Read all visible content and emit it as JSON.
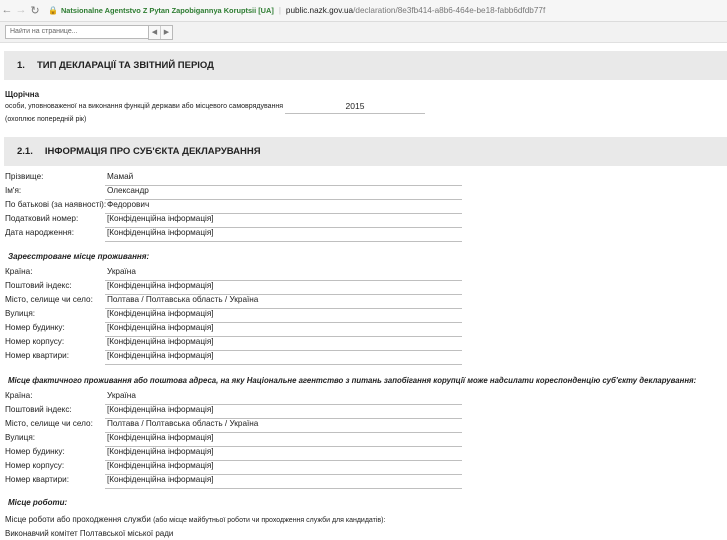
{
  "browser": {
    "site_name": "Natsionalne Agentstvo Z Pytan Zapobigannya Koruptsii [UA]",
    "host": "public.nazk.gov.ua",
    "path": "/declaration/8e3fb414-a8b6-464e-be18-fabb6dfdb77f"
  },
  "findbar": {
    "placeholder": "Найти на странице..."
  },
  "section1": {
    "number": "1.",
    "title": "ТИП ДЕКЛАРАЦІЇ ТА ЗВІТНИЙ ПЕРІОД",
    "type": "Щорічна",
    "desc": "особи, уповноваженої на виконання функцій держави або місцевого самоврядування",
    "period_note": "(охоплює попередній рік)",
    "year": "2015"
  },
  "section21": {
    "number": "2.1.",
    "title": "ІНФОРМАЦІЯ ПРО СУБ'ЄКТА ДЕКЛАРУВАННЯ",
    "personal": [
      {
        "label": "Прізвище:",
        "value": "Мамай"
      },
      {
        "label": "Ім'я:",
        "value": "Олександр"
      },
      {
        "label": "По батькові (за наявності):",
        "value": "Федорович"
      },
      {
        "label": "Податковий номер:",
        "value": "[Конфіденційна інформація]"
      },
      {
        "label": "Дата народження:",
        "value": "[Конфіденційна інформація]"
      }
    ],
    "registered_heading": "Зареєстроване місце проживання:",
    "registered": [
      {
        "label": "Країна:",
        "value": "Україна"
      },
      {
        "label": "Поштовий індекс:",
        "value": "[Конфіденційна інформація]"
      },
      {
        "label": "Місто, селище чи село:",
        "value": "Полтава / Полтавська область / Україна"
      },
      {
        "label": "Вулиця:",
        "value": "[Конфіденційна інформація]"
      },
      {
        "label": "Номер будинку:",
        "value": "[Конфіденційна інформація]"
      },
      {
        "label": "Номер корпусу:",
        "value": "[Конфіденційна інформація]"
      },
      {
        "label": "Номер квартири:",
        "value": "[Конфіденційна інформація]"
      }
    ],
    "actual_heading": "Місце фактичного проживання або поштова адреса, на яку Національне агентство з питань запобігання корупції може надсилати кореспонденцію суб'єкту декларування:",
    "actual": [
      {
        "label": "Країна:",
        "value": "Україна"
      },
      {
        "label": "Поштовий індекс:",
        "value": "[Конфіденційна інформація]"
      },
      {
        "label": "Місто, селище чи село:",
        "value": "Полтава / Полтавська область / Україна"
      },
      {
        "label": "Вулиця:",
        "value": "[Конфіденційна інформація]"
      },
      {
        "label": "Номер будинку:",
        "value": "[Конфіденційна інформація]"
      },
      {
        "label": "Номер корпусу:",
        "value": "[Конфіденційна інформація]"
      },
      {
        "label": "Номер квартири:",
        "value": "[Конфіденційна інформація]"
      }
    ],
    "work_heading": "Місце роботи:",
    "work_label": "Місце роботи або проходження служби",
    "work_note": "(або місце майбутньої роботи чи проходження служби для кандидатів):",
    "work_value": "Виконавчий комітет Полтавської міської ради"
  }
}
